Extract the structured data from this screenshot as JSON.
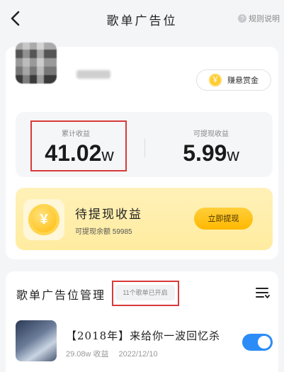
{
  "nav": {
    "title": "歌单广告位",
    "rules_label": "规则说明"
  },
  "profile": {
    "reward_button_label": "赚悬赏金",
    "reward_icon_glyph": "¥"
  },
  "stats": {
    "total_label": "累计收益",
    "total_value": "41.02",
    "total_unit": "w",
    "withdrawable_label": "可提现收益",
    "withdrawable_value": "5.99",
    "withdrawable_unit": "w"
  },
  "withdraw": {
    "title": "待提现收益",
    "subtitle": "可提现余额 59985",
    "button_label": "立即提现",
    "coin_glyph": "¥"
  },
  "manage": {
    "title": "歌单广告位管理",
    "enabled_badge": "11个歌单已开启"
  },
  "songs": [
    {
      "title": "【2018年】来给你一波回忆杀",
      "income": "29.08w 收益",
      "date": "2022/12/10",
      "enabled": true
    }
  ],
  "colors": {
    "accent_blue": "#2b8cf7",
    "accent_yellow": "#ffc21f",
    "highlight_red": "#d93a3a"
  }
}
